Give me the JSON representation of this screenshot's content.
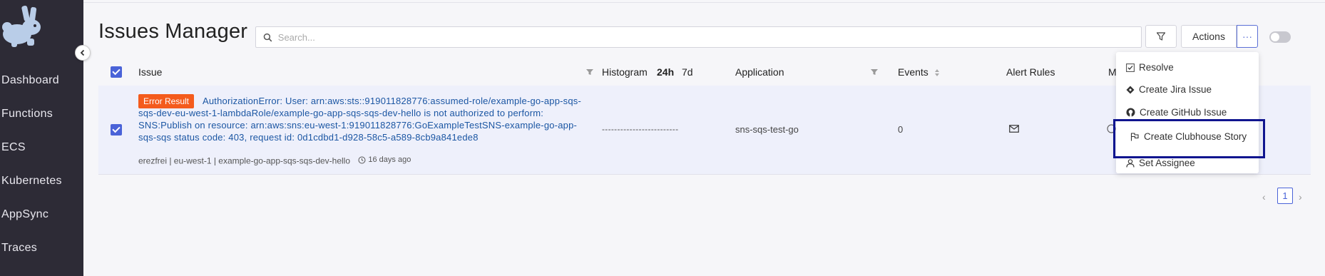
{
  "sidebar": {
    "items": [
      {
        "label": "Dashboard"
      },
      {
        "label": "Functions"
      },
      {
        "label": "ECS"
      },
      {
        "label": "Kubernetes"
      },
      {
        "label": "AppSync"
      },
      {
        "label": "Traces"
      }
    ]
  },
  "header": {
    "title": "Issues Manager",
    "search_placeholder": "Search...",
    "actions_label": "Actions",
    "more_label": "···"
  },
  "table": {
    "columns": {
      "issue": "Issue",
      "histogram": "Histogram",
      "range_24h": "24h",
      "range_7d": "7d",
      "application": "Application",
      "events": "Events",
      "alert_rules": "Alert Rules",
      "truncated": "M"
    },
    "rows": [
      {
        "badge": "Error Result",
        "title": "AuthorizationError: User: arn:aws:sts::919011828776:assumed-role/example-go-app-sqs-sqs-dev-eu-west-1-lambdaRole/example-go-app-sqs-sqs-dev-hello is not authorized to perform: SNS:Publish on resource: arn:aws:sns:eu-west-1:919011828776:GoExampleTestSNS-example-go-app-sqs-sqs status code: 403, request id: 0d1cdbd1-d928-58c5-a589-8cb9a841ede8",
        "meta": "erezfrei | eu-west-1 | example-go-app-sqs-sqs-dev-hello",
        "time": "16 days ago",
        "histogram": "-------------------------",
        "application": "sns-sqs-test-go",
        "events": "0"
      }
    ]
  },
  "dropdown": {
    "items": [
      {
        "label": "Resolve",
        "icon": "check-square-icon"
      },
      {
        "label": "Create Jira Issue",
        "icon": "jira-icon"
      },
      {
        "label": "Create GitHub Issue",
        "icon": "github-icon"
      },
      {
        "label": "Create Clubhouse Story",
        "icon": "clubhouse-flag-icon"
      },
      {
        "label": "Set Assignee",
        "icon": "user-icon"
      }
    ]
  },
  "pagination": {
    "current": "1",
    "prev": "‹",
    "next": "›"
  },
  "colors": {
    "sidebar_bg": "#2d2b36",
    "accent": "#4a63d8",
    "badge": "#f45b1c",
    "link": "#1b56a3",
    "highlight_box": "#10158f"
  }
}
